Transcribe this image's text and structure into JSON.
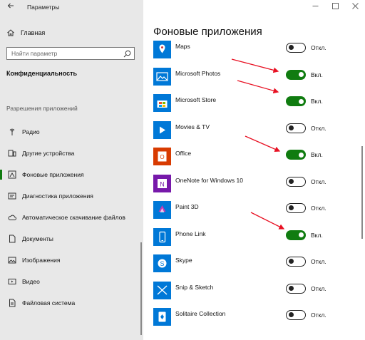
{
  "window": {
    "title": "Параметры"
  },
  "sidebar": {
    "home_label": "Главная",
    "search_placeholder": "Найти параметр",
    "section_title": "Конфиденциальность",
    "group_title": "Разрешения приложений",
    "items": [
      {
        "label": "Радио",
        "icon": "radio-icon",
        "active": false
      },
      {
        "label": "Другие устройства",
        "icon": "devices-icon",
        "active": false
      },
      {
        "label": "Фоновые приложения",
        "icon": "background-apps-icon",
        "active": true
      },
      {
        "label": "Диагностика приложения",
        "icon": "diagnostics-icon",
        "active": false
      },
      {
        "label": "Автоматическое скачивание файлов",
        "icon": "cloud-icon",
        "active": false
      },
      {
        "label": "Документы",
        "icon": "document-icon",
        "active": false
      },
      {
        "label": "Изображения",
        "icon": "image-icon",
        "active": false
      },
      {
        "label": "Видео",
        "icon": "video-icon",
        "active": false
      },
      {
        "label": "Файловая система",
        "icon": "file-system-icon",
        "active": false
      }
    ]
  },
  "main": {
    "title": "Фоновые приложения",
    "apps": [
      {
        "name": "Maps",
        "on": false,
        "state": "Откл.",
        "color": "#0078d7",
        "icon": "maps-icon"
      },
      {
        "name": "Microsoft Photos",
        "on": true,
        "state": "Вкл.",
        "color": "#0078d7",
        "icon": "photos-icon"
      },
      {
        "name": "Microsoft Store",
        "on": true,
        "state": "Вкл.",
        "color": "#0078d7",
        "icon": "store-icon"
      },
      {
        "name": "Movies & TV",
        "on": false,
        "state": "Откл.",
        "color": "#0078d7",
        "icon": "movies-icon"
      },
      {
        "name": "Office",
        "on": true,
        "state": "Вкл.",
        "color": "#d83b01",
        "icon": "office-icon"
      },
      {
        "name": "OneNote for Windows 10",
        "on": false,
        "state": "Откл.",
        "color": "#7719aa",
        "icon": "onenote-icon"
      },
      {
        "name": "Paint 3D",
        "on": false,
        "state": "Откл.",
        "color": "#0078d7",
        "icon": "paint3d-icon"
      },
      {
        "name": "Phone Link",
        "on": true,
        "state": "Вкл.",
        "color": "#0078d7",
        "icon": "phone-link-icon"
      },
      {
        "name": "Skype",
        "on": false,
        "state": "Откл.",
        "color": "#0078d7",
        "icon": "skype-icon"
      },
      {
        "name": "Snip & Sketch",
        "on": false,
        "state": "Откл.",
        "color": "#0078d7",
        "icon": "snip-icon"
      },
      {
        "name": "Solitaire Collection",
        "on": false,
        "state": "Откл.",
        "color": "#0078d7",
        "icon": "solitaire-icon"
      }
    ]
  },
  "colors": {
    "accent": "#107c10",
    "annotation": "#e81123",
    "sidebar_bg": "#e8e8e8"
  }
}
